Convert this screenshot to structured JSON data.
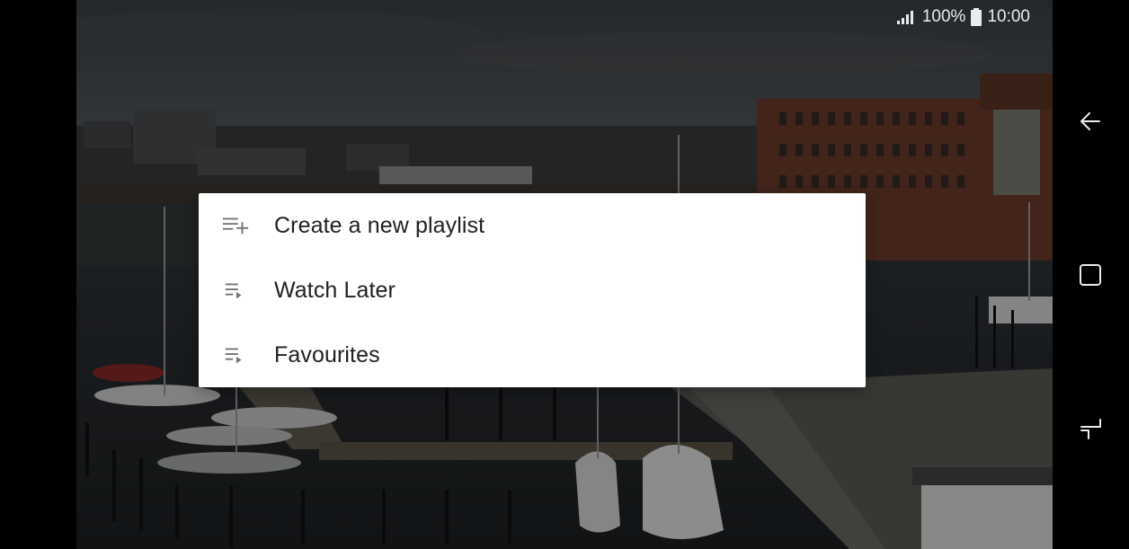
{
  "status_bar": {
    "signal_icon": "signal-bars-icon",
    "battery_percent": "100%",
    "battery_icon": "battery-full-icon",
    "time": "10:00"
  },
  "dialog": {
    "items": [
      {
        "label": "Create a new playlist",
        "icon": "playlist-add-icon"
      },
      {
        "label": "Watch Later",
        "icon": "playlist-play-icon"
      },
      {
        "label": "Favourites",
        "icon": "playlist-play-icon"
      }
    ]
  },
  "nav_bar": {
    "back_icon": "back-arrow-icon",
    "home_icon": "home-square-icon",
    "recents_icon": "recent-apps-icon"
  },
  "colors": {
    "dialog_bg": "#ffffff",
    "text": "#212121",
    "icon": "#757575",
    "system_ui": "#ffffff"
  }
}
